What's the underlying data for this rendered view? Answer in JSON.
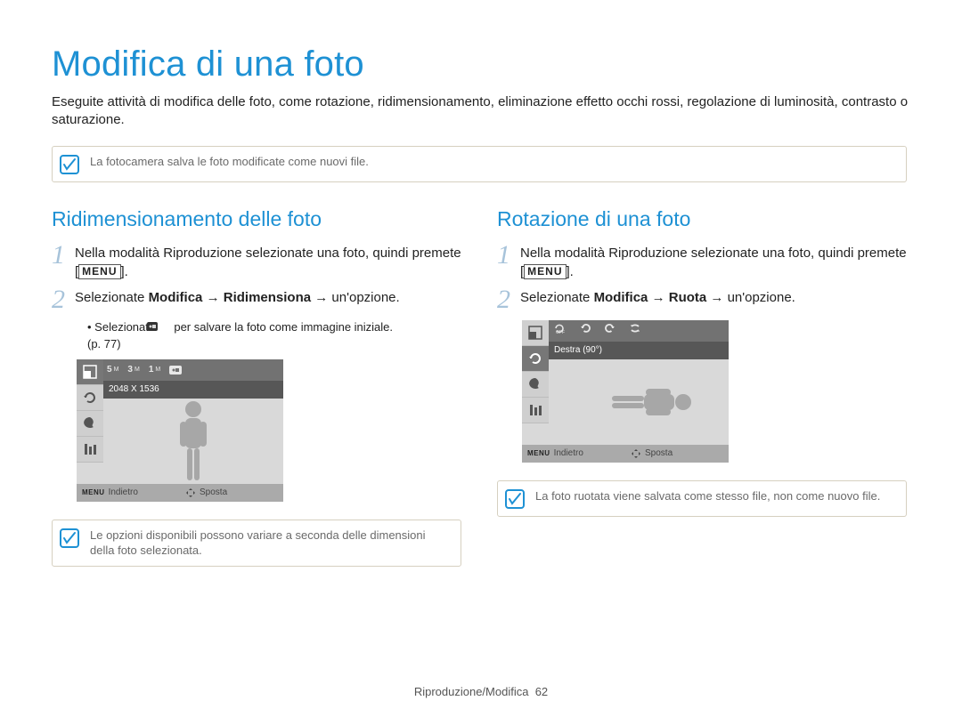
{
  "page_title": "Modifica di una foto",
  "intro": "Eseguite attività di modifica delle foto, come rotazione, ridimensionamento, eliminazione effetto occhi rossi, regolazione di luminosità, contrasto o saturazione.",
  "top_note": "La fotocamera salva le foto modificate come nuovi file.",
  "left": {
    "title": "Ridimensionamento delle foto",
    "step1_a": "Nella modalità Riproduzione selezionate una foto, quindi premete [",
    "step1_menu": "MENU",
    "step1_b": "].",
    "step2_prefix": "Selezionate ",
    "step2_bold": "Modifica → Ridimensiona",
    "step2_suffix": " → un'opzione.",
    "sub1_a": "Selezionate ",
    "sub1_b": " per salvare la foto come immagine iniziale.",
    "pref": "(p. 77)",
    "lcd_label": "2048 X 1536",
    "lcd_back": "Indietro",
    "lcd_move": "Sposta",
    "note": "Le opzioni disponibili possono variare a seconda delle dimensioni della foto selezionata.",
    "size_opts": [
      "5",
      "3",
      "1"
    ]
  },
  "right": {
    "title": "Rotazione di una foto",
    "step1_a": "Nella modalità Riproduzione selezionate una foto, quindi premete [",
    "step1_menu": "MENU",
    "step1_b": "].",
    "step2_prefix": "Selezionate ",
    "step2_bold": "Modifica → Ruota",
    "step2_suffix": " → un'opzione.",
    "lcd_label": "Destra (90°)",
    "lcd_back": "Indietro",
    "lcd_move": "Sposta",
    "note": "La foto ruotata viene salvata come stesso file, non come nuovo file."
  },
  "footer_section": "Riproduzione/Modifica",
  "footer_page": "62"
}
